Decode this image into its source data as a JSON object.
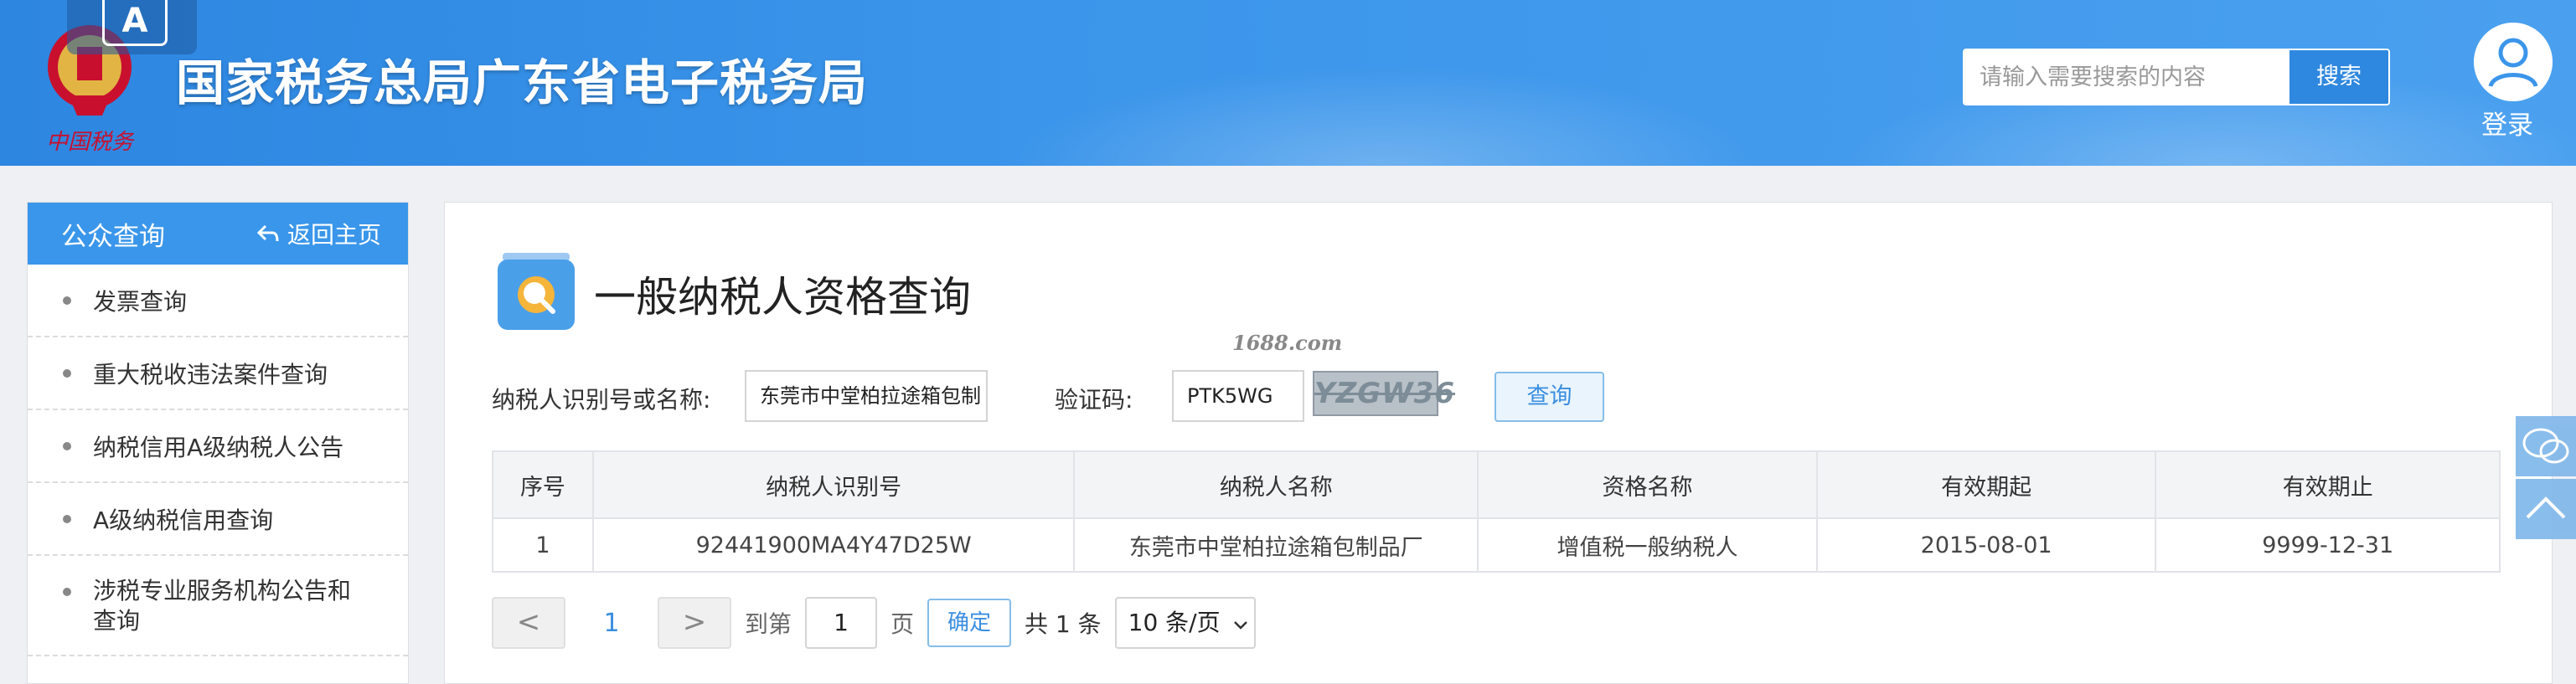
{
  "header": {
    "accessibility_badge": "A",
    "site_title": "国家税务总局广东省电子税务局",
    "emblem_text": "中国税务",
    "search": {
      "placeholder": "请输入需要搜索的内容",
      "button_label": "搜索"
    },
    "login_label": "登录"
  },
  "sidebar": {
    "title": "公众查询",
    "back_label": "返回主页",
    "items": [
      {
        "label": "发票查询"
      },
      {
        "label": "重大税收违法案件查询"
      },
      {
        "label": "纳税信用A级纳税人公告"
      },
      {
        "label": "A级纳税信用查询"
      },
      {
        "label": "涉税专业服务机构公告和查询"
      }
    ]
  },
  "main": {
    "title": "一般纳税人资格查询",
    "form": {
      "taxpayer_label": "纳税人识别号或名称:",
      "taxpayer_value": "东莞市中堂柏拉途箱包制",
      "captcha_label": "验证码:",
      "captcha_value": "PTK5WG",
      "captcha_image_text": "YZGW36",
      "query_button": "查询",
      "watermark": "1688.com"
    },
    "table": {
      "columns": [
        "序号",
        "纳税人识别号",
        "纳税人名称",
        "资格名称",
        "有效期起",
        "有效期止"
      ],
      "rows": [
        [
          "1",
          "92441900MA4Y47D25W",
          "东莞市中堂柏拉途箱包制品厂",
          "增值税一般纳税人",
          "2015-08-01",
          "9999-12-31"
        ]
      ]
    },
    "pager": {
      "prev": "<",
      "current_page": "1",
      "next": ">",
      "goto_label": "到第",
      "page_input": "1",
      "page_unit": "页",
      "confirm": "确定",
      "total": "共 1 条",
      "page_size": "10 条/页"
    }
  },
  "colors": {
    "header_blue": "#3b95ea",
    "accent_blue": "#3a8ee0",
    "sidebar_head": "#3a96ea"
  }
}
